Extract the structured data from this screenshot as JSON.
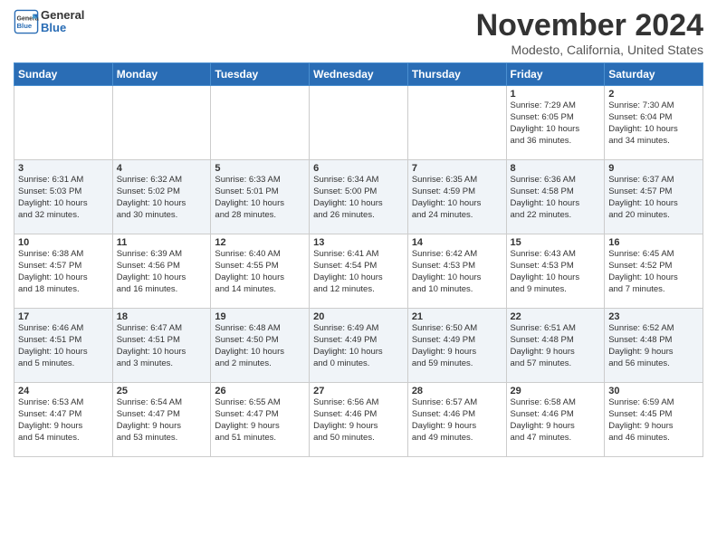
{
  "header": {
    "logo_line1": "General",
    "logo_line2": "Blue",
    "month": "November 2024",
    "location": "Modesto, California, United States"
  },
  "days_of_week": [
    "Sunday",
    "Monday",
    "Tuesday",
    "Wednesday",
    "Thursday",
    "Friday",
    "Saturday"
  ],
  "weeks": [
    [
      {
        "day": "",
        "info": ""
      },
      {
        "day": "",
        "info": ""
      },
      {
        "day": "",
        "info": ""
      },
      {
        "day": "",
        "info": ""
      },
      {
        "day": "",
        "info": ""
      },
      {
        "day": "1",
        "info": "Sunrise: 7:29 AM\nSunset: 6:05 PM\nDaylight: 10 hours\nand 36 minutes."
      },
      {
        "day": "2",
        "info": "Sunrise: 7:30 AM\nSunset: 6:04 PM\nDaylight: 10 hours\nand 34 minutes."
      }
    ],
    [
      {
        "day": "3",
        "info": "Sunrise: 6:31 AM\nSunset: 5:03 PM\nDaylight: 10 hours\nand 32 minutes."
      },
      {
        "day": "4",
        "info": "Sunrise: 6:32 AM\nSunset: 5:02 PM\nDaylight: 10 hours\nand 30 minutes."
      },
      {
        "day": "5",
        "info": "Sunrise: 6:33 AM\nSunset: 5:01 PM\nDaylight: 10 hours\nand 28 minutes."
      },
      {
        "day": "6",
        "info": "Sunrise: 6:34 AM\nSunset: 5:00 PM\nDaylight: 10 hours\nand 26 minutes."
      },
      {
        "day": "7",
        "info": "Sunrise: 6:35 AM\nSunset: 4:59 PM\nDaylight: 10 hours\nand 24 minutes."
      },
      {
        "day": "8",
        "info": "Sunrise: 6:36 AM\nSunset: 4:58 PM\nDaylight: 10 hours\nand 22 minutes."
      },
      {
        "day": "9",
        "info": "Sunrise: 6:37 AM\nSunset: 4:57 PM\nDaylight: 10 hours\nand 20 minutes."
      }
    ],
    [
      {
        "day": "10",
        "info": "Sunrise: 6:38 AM\nSunset: 4:57 PM\nDaylight: 10 hours\nand 18 minutes."
      },
      {
        "day": "11",
        "info": "Sunrise: 6:39 AM\nSunset: 4:56 PM\nDaylight: 10 hours\nand 16 minutes."
      },
      {
        "day": "12",
        "info": "Sunrise: 6:40 AM\nSunset: 4:55 PM\nDaylight: 10 hours\nand 14 minutes."
      },
      {
        "day": "13",
        "info": "Sunrise: 6:41 AM\nSunset: 4:54 PM\nDaylight: 10 hours\nand 12 minutes."
      },
      {
        "day": "14",
        "info": "Sunrise: 6:42 AM\nSunset: 4:53 PM\nDaylight: 10 hours\nand 10 minutes."
      },
      {
        "day": "15",
        "info": "Sunrise: 6:43 AM\nSunset: 4:53 PM\nDaylight: 10 hours\nand 9 minutes."
      },
      {
        "day": "16",
        "info": "Sunrise: 6:45 AM\nSunset: 4:52 PM\nDaylight: 10 hours\nand 7 minutes."
      }
    ],
    [
      {
        "day": "17",
        "info": "Sunrise: 6:46 AM\nSunset: 4:51 PM\nDaylight: 10 hours\nand 5 minutes."
      },
      {
        "day": "18",
        "info": "Sunrise: 6:47 AM\nSunset: 4:51 PM\nDaylight: 10 hours\nand 3 minutes."
      },
      {
        "day": "19",
        "info": "Sunrise: 6:48 AM\nSunset: 4:50 PM\nDaylight: 10 hours\nand 2 minutes."
      },
      {
        "day": "20",
        "info": "Sunrise: 6:49 AM\nSunset: 4:49 PM\nDaylight: 10 hours\nand 0 minutes."
      },
      {
        "day": "21",
        "info": "Sunrise: 6:50 AM\nSunset: 4:49 PM\nDaylight: 9 hours\nand 59 minutes."
      },
      {
        "day": "22",
        "info": "Sunrise: 6:51 AM\nSunset: 4:48 PM\nDaylight: 9 hours\nand 57 minutes."
      },
      {
        "day": "23",
        "info": "Sunrise: 6:52 AM\nSunset: 4:48 PM\nDaylight: 9 hours\nand 56 minutes."
      }
    ],
    [
      {
        "day": "24",
        "info": "Sunrise: 6:53 AM\nSunset: 4:47 PM\nDaylight: 9 hours\nand 54 minutes."
      },
      {
        "day": "25",
        "info": "Sunrise: 6:54 AM\nSunset: 4:47 PM\nDaylight: 9 hours\nand 53 minutes."
      },
      {
        "day": "26",
        "info": "Sunrise: 6:55 AM\nSunset: 4:47 PM\nDaylight: 9 hours\nand 51 minutes."
      },
      {
        "day": "27",
        "info": "Sunrise: 6:56 AM\nSunset: 4:46 PM\nDaylight: 9 hours\nand 50 minutes."
      },
      {
        "day": "28",
        "info": "Sunrise: 6:57 AM\nSunset: 4:46 PM\nDaylight: 9 hours\nand 49 minutes."
      },
      {
        "day": "29",
        "info": "Sunrise: 6:58 AM\nSunset: 4:46 PM\nDaylight: 9 hours\nand 47 minutes."
      },
      {
        "day": "30",
        "info": "Sunrise: 6:59 AM\nSunset: 4:45 PM\nDaylight: 9 hours\nand 46 minutes."
      }
    ]
  ]
}
